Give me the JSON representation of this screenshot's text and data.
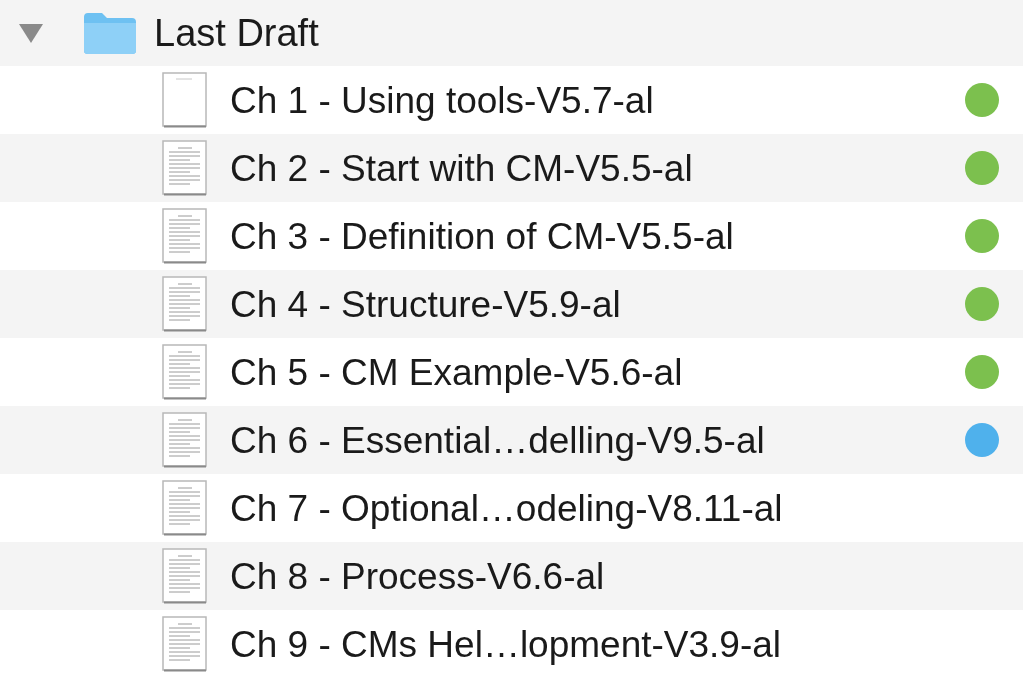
{
  "folder": {
    "name": "Last Draft",
    "expanded": true
  },
  "files": [
    {
      "name": "Ch 1 - Using tools-V5.7-al",
      "kind": "blank",
      "color": "#7cc04e"
    },
    {
      "name": "Ch 2 - Start with CM-V5.5-al",
      "kind": "text",
      "color": "#7cc04e"
    },
    {
      "name": "Ch 3 - Definition of CM-V5.5-al",
      "kind": "text",
      "color": "#7cc04e"
    },
    {
      "name": "Ch 4 - Structure-V5.9-al",
      "kind": "text",
      "color": "#7cc04e"
    },
    {
      "name": "Ch 5 - CM Example-V5.6-al",
      "kind": "text",
      "color": "#7cc04e"
    },
    {
      "name": "Ch 6 - Essential…delling-V9.5-al",
      "kind": "text",
      "color": "#4fb1ec"
    },
    {
      "name": "Ch 7 - Optional…odeling-V8.11-al",
      "kind": "text"
    },
    {
      "name": "Ch 8 - Process-V6.6-al",
      "kind": "text"
    },
    {
      "name": "Ch 9 - CMs Hel…lopment-V3.9-al",
      "kind": "text"
    }
  ]
}
